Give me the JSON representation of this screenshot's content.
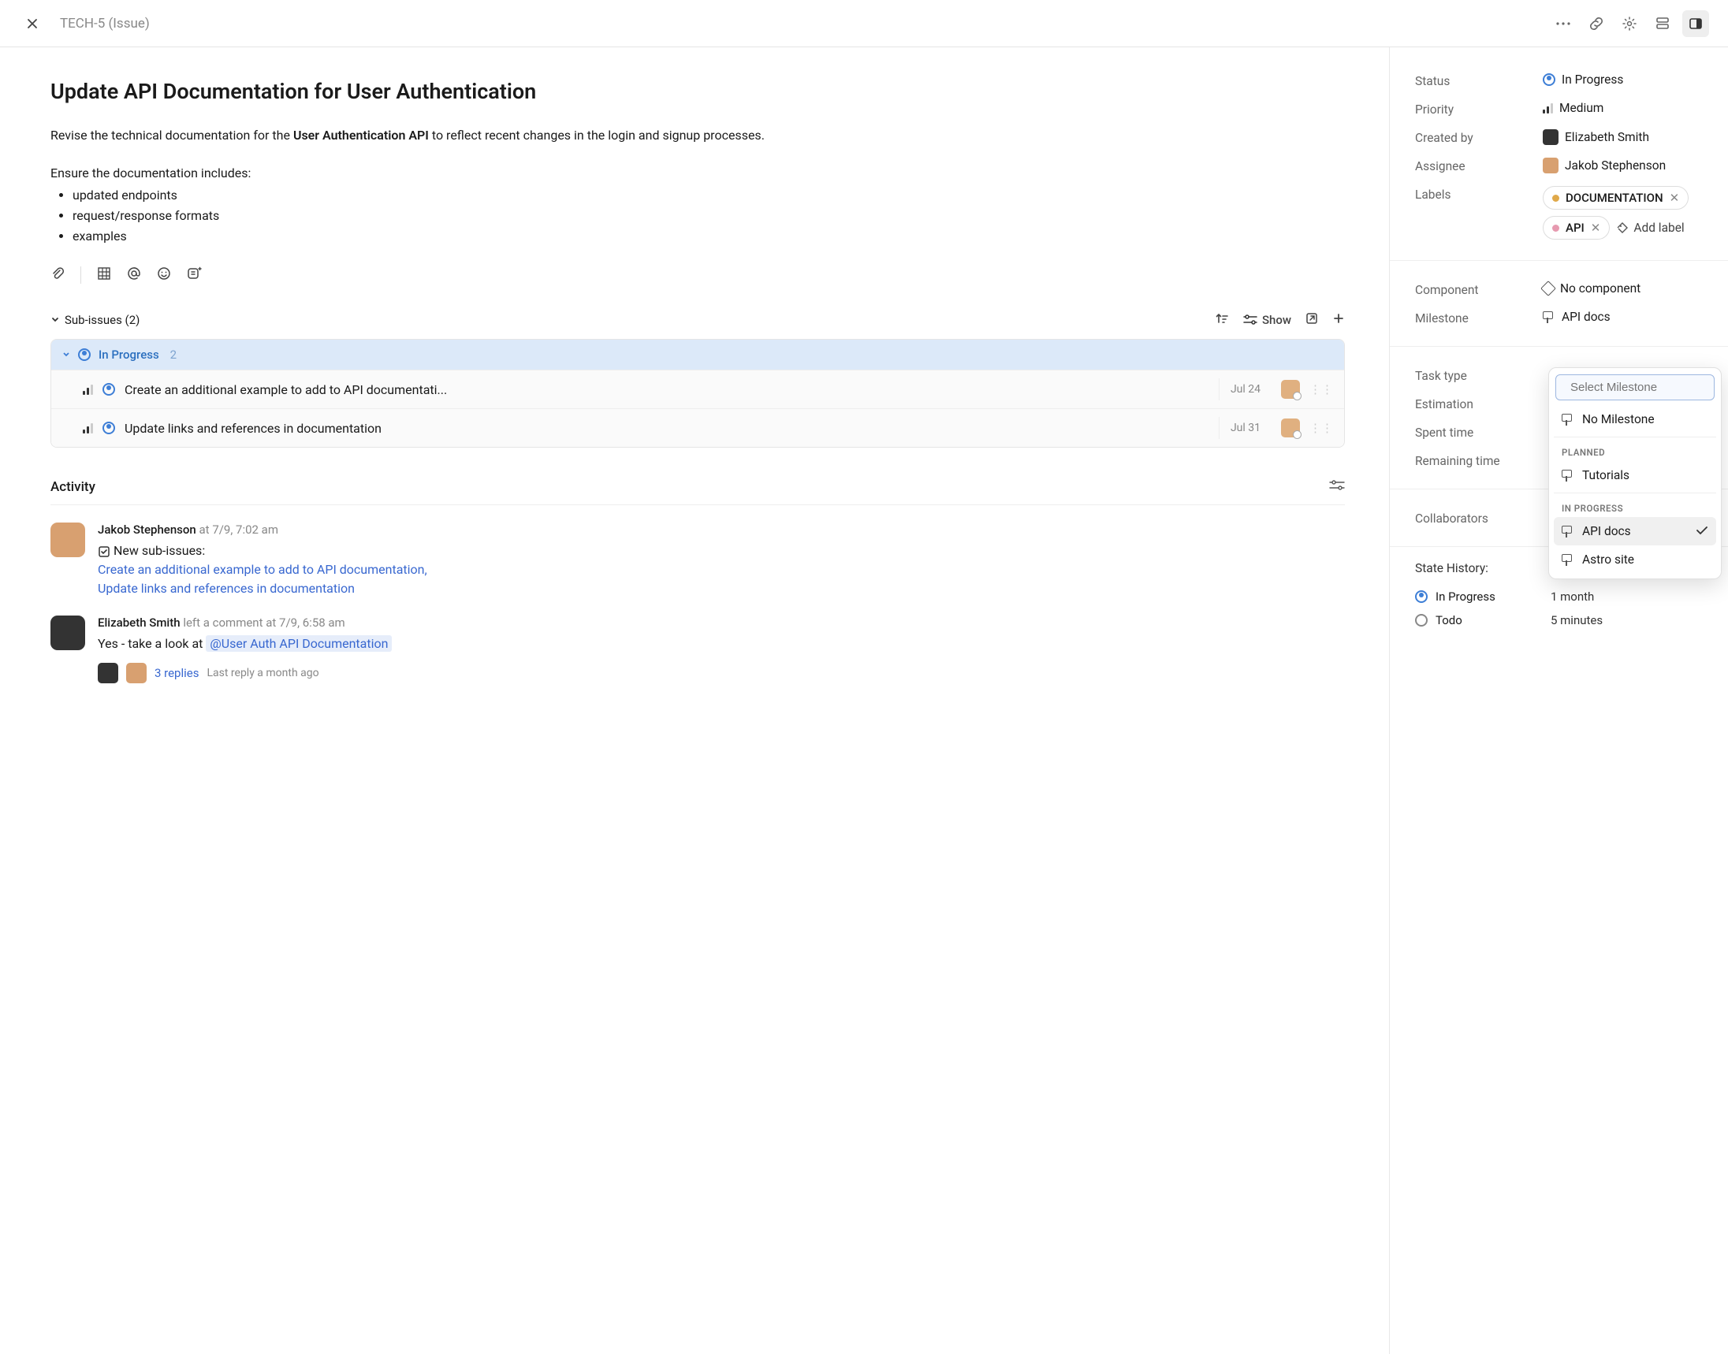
{
  "header": {
    "issue_id": "TECH-5",
    "issue_tag": "(Issue)"
  },
  "main": {
    "title": "Update API Documentation for User Authentication",
    "desc_p1_a": "Revise the technical documentation for the ",
    "desc_p1_b": "User Authentication API",
    "desc_p1_c": " to reflect recent changes in the login and signup processes.",
    "desc_p2": "Ensure the documentation includes:",
    "bullets": [
      "updated endpoints",
      "request/response formats",
      "examples"
    ],
    "subissues_label": "Sub-issues (2)",
    "show_label": "Show",
    "group": {
      "name": "In Progress",
      "count": "2"
    },
    "subissues": [
      {
        "title": "Create an additional example to add to API documentati...",
        "date": "Jul 24"
      },
      {
        "title": "Update links and references in documentation",
        "date": "Jul 31"
      }
    ],
    "activity_label": "Activity",
    "activity": [
      {
        "author": "Jakob Stephenson",
        "action_prefix": "at",
        "time": "7/9, 7:02 am",
        "event_label": "New sub-issues:",
        "links": [
          "Create an additional example to add to API documentation,",
          "Update links and references in documentation"
        ]
      },
      {
        "author": "Elizabeth Smith",
        "action": "left a comment at",
        "time": "7/9, 6:58 am",
        "text_a": "Yes - take a look at ",
        "mention": "@User Auth API Documentation",
        "replies_count": "3 replies",
        "last_reply": "Last reply  a month ago"
      }
    ]
  },
  "sidebar": {
    "fields": {
      "status_label": "Status",
      "status_value": "In Progress",
      "priority_label": "Priority",
      "priority_value": "Medium",
      "createdby_label": "Created by",
      "createdby_value": "Elizabeth Smith",
      "assignee_label": "Assignee",
      "assignee_value": "Jakob Stephenson",
      "labels_label": "Labels",
      "labels": [
        {
          "name": "DOCUMENTATION",
          "color": "#e0a94a"
        },
        {
          "name": "API",
          "color": "#e79ab0"
        }
      ],
      "add_label": "Add label",
      "component_label": "Component",
      "component_value": "No component",
      "milestone_label": "Milestone",
      "milestone_value": "API docs",
      "tasktype_label": "Task type",
      "estimation_label": "Estimation",
      "spenttime_label": "Spent time",
      "remaining_label": "Remaining time",
      "collaborators_label": "Collaborators"
    },
    "history_label": "State History:",
    "history": [
      {
        "name": "In Progress",
        "duration": "1 month",
        "kind": "progress"
      },
      {
        "name": "Todo",
        "duration": "5 minutes",
        "kind": "todo"
      }
    ]
  },
  "popover": {
    "placeholder": "Select Milestone",
    "no_milestone": "No Milestone",
    "groups": [
      {
        "label": "PLANNED",
        "items": [
          {
            "name": "Tutorials",
            "selected": false
          }
        ]
      },
      {
        "label": "IN PROGRESS",
        "items": [
          {
            "name": "API docs",
            "selected": true
          },
          {
            "name": "Astro site",
            "selected": false
          }
        ]
      }
    ]
  }
}
